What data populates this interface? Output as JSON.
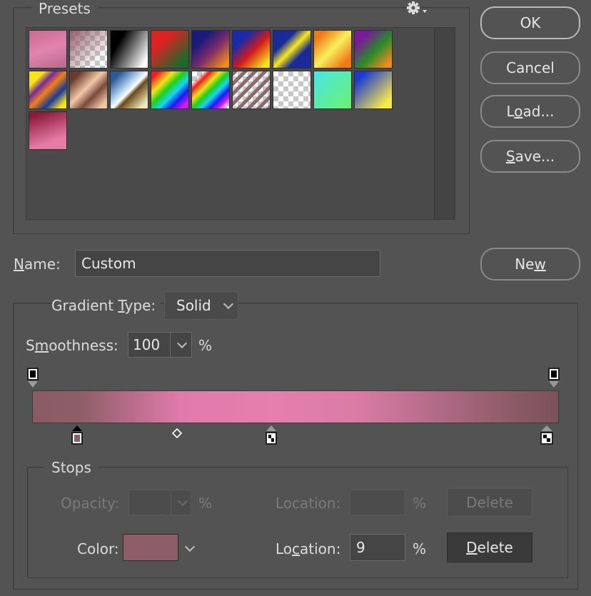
{
  "presets": {
    "title": "Presets",
    "swatches": [
      "Pink",
      "Pink to transparent",
      "Black white",
      "Red green",
      "Blue orange",
      "Blue red yellow",
      "Blue yellow blue",
      "Orange yellow orange",
      "Violet green orange",
      "Yellow violet orange blue",
      "Copper",
      "Chrome",
      "Spectrum",
      "Transparent rainbow",
      "Transparent stripes",
      "Transparent",
      "Aqua green",
      "Blue yellow",
      "Maroon pink"
    ]
  },
  "buttons": {
    "ok": "OK",
    "cancel": "Cancel",
    "load_pre": "L",
    "load_u": "o",
    "load_post": "ad...",
    "save_u": "S",
    "save_post": "ave...",
    "new_pre": "Ne",
    "new_u": "w"
  },
  "name": {
    "label_u": "N",
    "label_post": "ame:",
    "value": "Custom"
  },
  "gradient": {
    "type_pre": "Gradient ",
    "type_u": "T",
    "type_post": "ype:",
    "type_value": "Solid",
    "smooth_pre": "S",
    "smooth_u": "m",
    "smooth_post": "oothness:",
    "smooth_value": "100",
    "smooth_unit": "%",
    "colors": {
      "left": "#8a5a66",
      "midpoint": "#e07aaa",
      "center": "#e57fae",
      "right": "#7a525c"
    }
  },
  "stops": {
    "title": "Stops",
    "opacity_label": "Opacity:",
    "opacity_value": "",
    "opacity_unit": "%",
    "location_label": "Location:",
    "location_value_top": "",
    "location_unit_top": "%",
    "delete_label": "Delete",
    "color_label": "Color:",
    "color_value": "#8e5e68",
    "loc2_pre": "Lo",
    "loc2_u": "c",
    "loc2_post": "ation:",
    "location_value": "9",
    "location_unit": "%",
    "delete_u": "D",
    "delete_post": "elete"
  }
}
